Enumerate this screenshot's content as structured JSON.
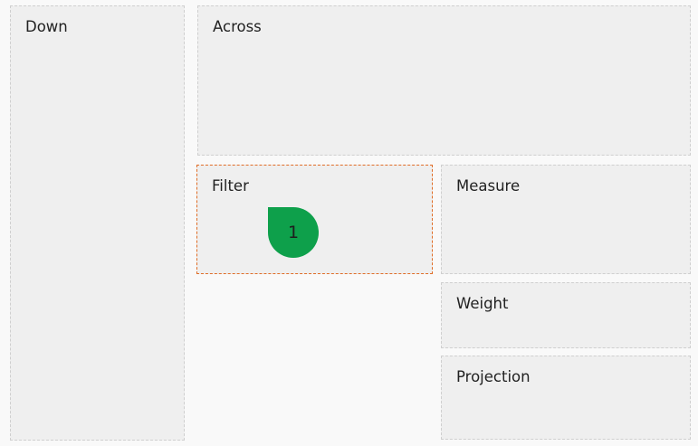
{
  "zones": {
    "down": "Down",
    "across": "Across",
    "filter": "Filter",
    "measure": "Measure",
    "weight": "Weight",
    "projection": "Projection"
  },
  "active_zone": "filter",
  "drop_marker": {
    "label": "1",
    "color": "#0ea04b"
  },
  "colors": {
    "active_border": "#e06d27",
    "zone_border": "#cfcfcf",
    "zone_background": "#efefef"
  }
}
